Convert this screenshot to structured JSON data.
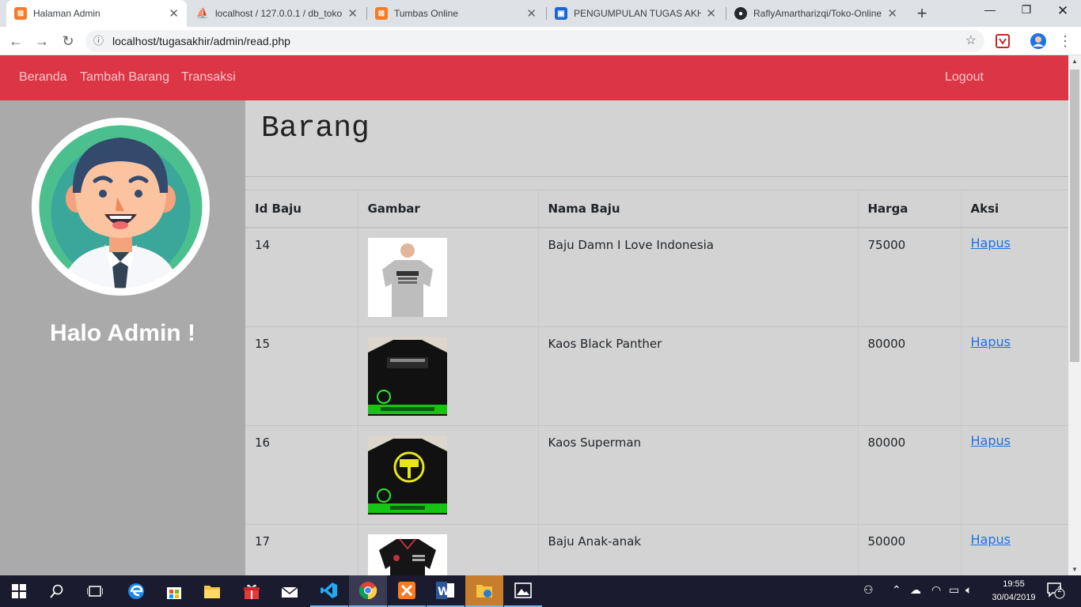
{
  "browser": {
    "tabs": [
      {
        "label": "Halaman Admin",
        "icon": "xampp-icon",
        "active": true
      },
      {
        "label": "localhost / 127.0.0.1 / db_toko",
        "icon": "phpmyadmin-icon",
        "active": false
      },
      {
        "label": "Tumbas Online",
        "icon": "xampp-icon",
        "active": false
      },
      {
        "label": "PENGUMPULAN TUGAS AKHIR",
        "icon": "classroom-icon",
        "active": false
      },
      {
        "label": "RaflyAmartharizqi/Toko-Online",
        "icon": "github-icon",
        "active": false
      }
    ],
    "url": "localhost/tugasakhir/admin/read.php"
  },
  "navbar": {
    "beranda": "Beranda",
    "tambah": "Tambah Barang",
    "transaksi": "Transaksi",
    "logout": "Logout"
  },
  "sidebar": {
    "greeting": "Halo Admin !"
  },
  "main": {
    "title": "Barang",
    "columns": [
      "Id Baju",
      "Gambar",
      "Nama Baju",
      "Harga",
      "Aksi"
    ],
    "rows": [
      {
        "id": "14",
        "name": "Baju Damn I Love Indonesia",
        "price": "75000",
        "action": "Hapus",
        "image": "grey-tshirt",
        "print": "DMNI I LOVE INDONESIA"
      },
      {
        "id": "15",
        "name": "Kaos Black Panther",
        "price": "80000",
        "action": "Hapus",
        "image": "black-tshirt-panther",
        "print": "BLACK PANTHER FONT HD"
      },
      {
        "id": "16",
        "name": "Kaos Superman",
        "price": "80000",
        "action": "Hapus",
        "image": "black-tshirt-thor",
        "print": "THOR LOGO HD"
      },
      {
        "id": "17",
        "name": "Baju Anak-anak",
        "price": "50000",
        "action": "Hapus",
        "image": "black-polo-kids",
        "print": ""
      }
    ]
  },
  "taskbar": {
    "time": "19:55",
    "date": "30/04/2019",
    "notifications": "2"
  },
  "colors": {
    "navbar": "#dc3545",
    "sidebar": "#aaaaaa",
    "content": "#d3d3d3",
    "link": "#1a73e8"
  }
}
